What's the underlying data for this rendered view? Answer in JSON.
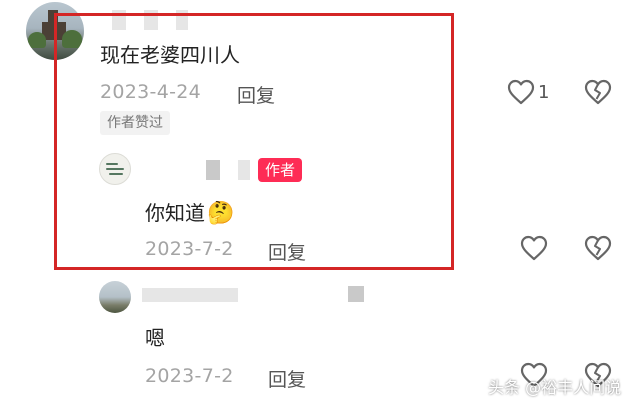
{
  "comment": {
    "text": "现在老婆四川人",
    "date": "2023-4-24",
    "reply_label": "回复",
    "author_liked_badge": "作者赞过",
    "like_count": "1"
  },
  "author_reply": {
    "author_badge": "作者",
    "text": "你知道",
    "emoji": "🤔",
    "date": "2023-7-2",
    "reply_label": "回复"
  },
  "second_reply": {
    "text": "嗯",
    "date": "2023-7-2",
    "reply_label": "回复"
  },
  "icons": {
    "like": "heart-outline-icon",
    "dislike": "broken-heart-icon"
  },
  "colors": {
    "highlight_box": "#d42626",
    "author_badge": "#fe2c55",
    "date_text": "#a4a4a4"
  },
  "watermark": "头条 @裕丰人间说"
}
